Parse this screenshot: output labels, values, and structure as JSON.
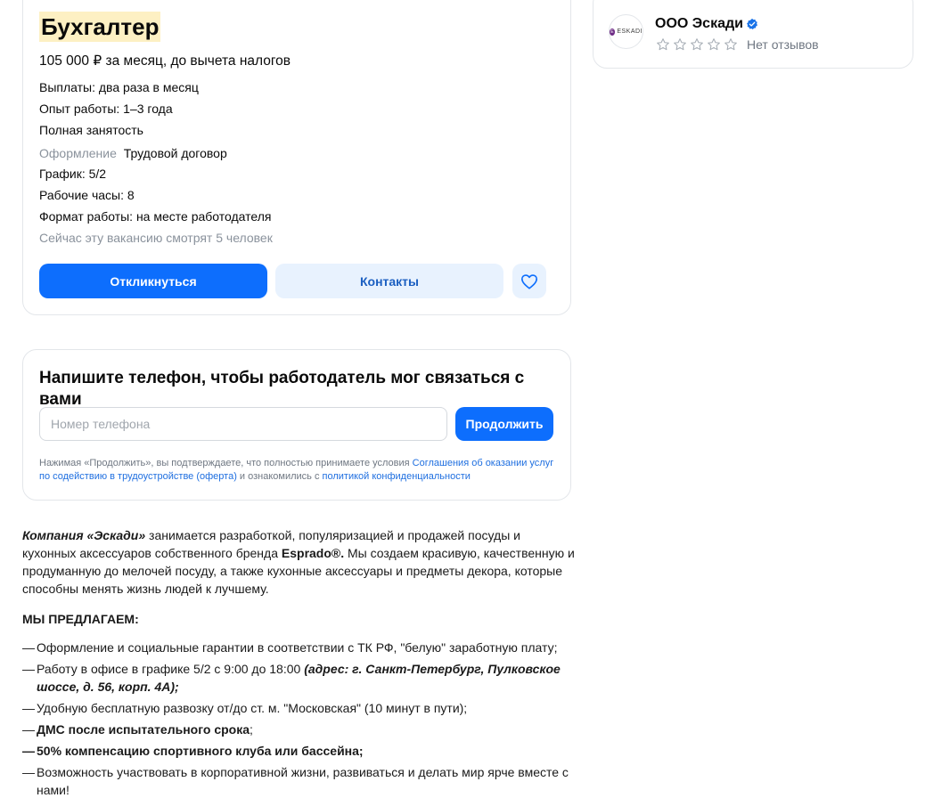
{
  "vacancy": {
    "title": "Бухгалтер",
    "salary": "105 000 ₽ за месяц, до вычета налогов",
    "payments": "Выплаты: два раза в месяц",
    "experience": "Опыт работы: 1–3 года",
    "employment": "Полная занятость",
    "registration_label": "Оформление",
    "registration_value": "Трудовой договор",
    "schedule": "График: 5/2",
    "hours": "Рабочие часы: 8",
    "format": "Формат работы: на месте работодателя",
    "viewers": "Сейчас эту вакансию смотрят 5 человек",
    "apply_label": "Откликнуться",
    "contacts_label": "Контакты"
  },
  "company": {
    "logo_text": "ESKADI",
    "name": "ООО Эскади",
    "rating_stars": 0,
    "reviews": "Нет отзывов"
  },
  "phone_form": {
    "title": "Напишите телефон, чтобы работодатель мог связаться с вами",
    "placeholder": "Номер телефона",
    "value": "",
    "continue_label": "Продолжить",
    "consent_prefix": "Нажимая «Продолжить», вы подтверждаете, что полностью принимаете условия ",
    "consent_link1": "Соглашения об оказании услуг по содействию в трудоустройстве (оферта)",
    "consent_middle": " и ознакомились с ",
    "consent_link2": "политикой конфиденциальности"
  },
  "description": {
    "intro_company": "Компания «Эскади»",
    "intro_part1": " занимается разработкой, популяризацией и продажей посуды и кухонных аксессуаров собственного бренда ",
    "intro_brand": "Esprado®.",
    "intro_part2": " Мы создаем красивую, качественную и продуманную до мелочей посуду, а также кухонные аксессуары и предметы декора, которые способны менять жизнь людей к лучшему.",
    "offer_heading": "МЫ ПРЕДЛАГАЕМ:",
    "offer1": "Оформление и социальные гарантии в соответствии с ТК РФ, \"белую\" заработную плату;",
    "offer2_text": "Работу в офисе в графике 5/2 с 9:00 до 18:00 ",
    "offer2_address": "(адрес: г. Санкт-Петербург, Пулковское шоссе, д. 56, корп. 4А);",
    "offer3": "Удобную бесплатную развозку от/до ст. м. \"Московская\" (10 минут в пути);",
    "offer4_bold": "ДМС после испытательного срока",
    "offer4_tail": ";",
    "offer5": "50% компенсацию спортивного клуба или бассейна;",
    "offer6": "Возможность участвовать в корпоративной жизни, развиваться и делать мир ярче вместе с нами!"
  },
  "colors": {
    "accent": "#0d6efd",
    "title_highlight": "#fdf0c3",
    "verified": "#1a73e8",
    "logo_brand": "#6f2d86"
  }
}
